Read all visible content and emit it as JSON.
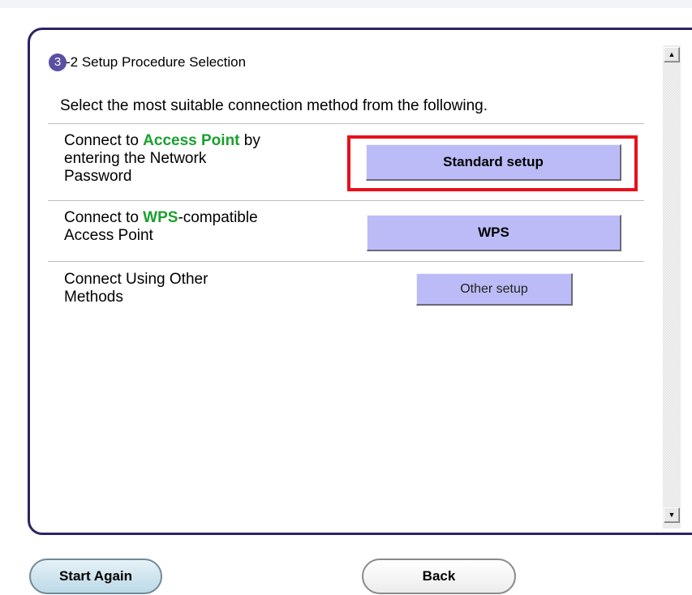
{
  "step": {
    "badge": "3",
    "title": "-2 Setup Procedure Selection"
  },
  "instruction": "Select the most suitable connection method from the following.",
  "options": [
    {
      "text_before": "Connect to ",
      "highlight": "Access Point",
      "text_after_line1": " by",
      "line2": "entering the Network",
      "line3": "Password",
      "button_label": "Standard setup"
    },
    {
      "text_before": "Connect to ",
      "highlight": "WPS",
      "text_after_line1": "-compatible",
      "line2": "Access Point",
      "button_label": "WPS"
    },
    {
      "line1": "Connect Using Other",
      "line2": "Methods",
      "button_label": "Other setup"
    }
  ],
  "footer": {
    "start_again_label": "Start Again",
    "back_label": "Back"
  },
  "icons": {
    "scroll_up": "arrow-up-icon",
    "scroll_down": "arrow-down-icon"
  },
  "colors": {
    "panel_border": "#2b2462",
    "badge": "#5a4fa0",
    "highlight_text": "#1aa02e",
    "button_fill": "#bbbcf7",
    "focus_box": "#e8101a"
  }
}
